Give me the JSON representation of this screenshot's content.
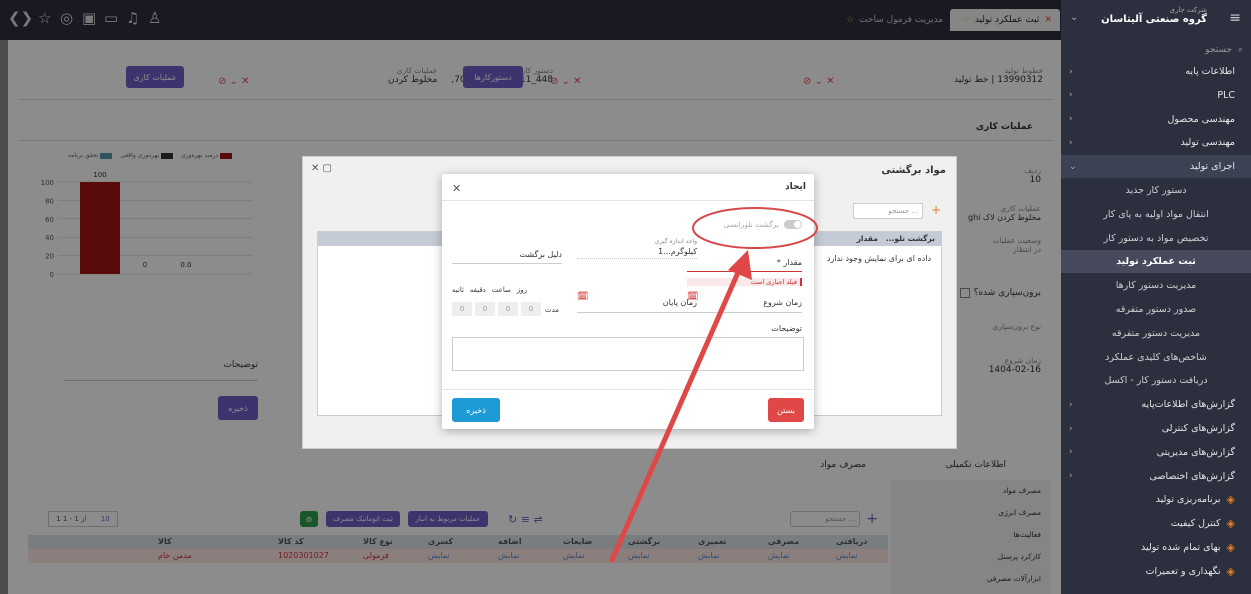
{
  "topbar": {
    "company_label": "شرکت جاری",
    "company_name": "گروه صنعتی آلیتاسان",
    "tab_active": "ثبت عملکرد تولید",
    "tab_inactive": "مدیریت فرمول ساخت"
  },
  "sidebar": {
    "search_placeholder": "جستجو",
    "items": [
      {
        "label": "اطلاعات پایه",
        "type": "group"
      },
      {
        "label": "PLC",
        "type": "group"
      },
      {
        "label": "مهندسی محصول",
        "type": "group"
      },
      {
        "label": "مهندسی تولید",
        "type": "group"
      },
      {
        "label": "اجرای تولید",
        "type": "open"
      },
      {
        "label": "دستور کار جدید",
        "type": "sub"
      },
      {
        "label": "انتقال مواد اولیه به پای کار",
        "type": "sub"
      },
      {
        "label": "تخصیص مواد به دستور کار",
        "type": "sub"
      },
      {
        "label": "ثبت عملکرد تولید",
        "type": "selected"
      },
      {
        "label": "مدیریت دستور کارها",
        "type": "sub"
      },
      {
        "label": "صدور دستور متفرقه",
        "type": "sub"
      },
      {
        "label": "مدیریت دستور متفرقه",
        "type": "sub"
      },
      {
        "label": "شاخص‌های کلیدی عملکرد",
        "type": "sub"
      },
      {
        "label": "دریافت دستور کار - اکسل",
        "type": "sub"
      },
      {
        "label": "گزارش‌های اطلاعات‌پایه",
        "type": "group"
      },
      {
        "label": "گزارش‌های کنترلی",
        "type": "group"
      },
      {
        "label": "گزارش‌های مدیریتی",
        "type": "group"
      },
      {
        "label": "گزارش‌های اختصاصی",
        "type": "group"
      },
      {
        "label": "برنامه‌ریزی تولید",
        "type": "module"
      },
      {
        "label": "کنترل کیفیت",
        "type": "module"
      },
      {
        "label": "بهای تمام شده تولید",
        "type": "module"
      },
      {
        "label": "نگهداری و تعمیرات",
        "type": "module"
      }
    ]
  },
  "header_row": {
    "line_label": "خطوط تولید",
    "line_value": "13990312 | خط تولید",
    "order_label": "دستور کار",
    "order_value": "448_13990311 بچ 707,",
    "orders_button": "دستورکارها",
    "op_label": "عملیات کاری",
    "op_value": "مخلوط کردن",
    "ops_button": "عملیات کاری"
  },
  "work_ops": {
    "title": "عملیات کاری",
    "row_label": "ردیف",
    "row_value": "10",
    "op_label": "عملیات کاری",
    "op_value": "مخلوط کردن لاک ghi",
    "status_label": "وضعیت عملیات",
    "status_value": "در انتظار",
    "outsource_label": "برون‌سپاری شده؟",
    "outsource_type_label": "نوع برون‌سپاری",
    "start_label": "زمان شروع",
    "start_value": "1404-02-16"
  },
  "chart_area": {
    "legend": [
      "درصد بهره‌وری",
      "بهره‌وری واقعی",
      "تحقق برنامه"
    ],
    "y_ticks": [
      "100",
      "80",
      "60",
      "40",
      "20",
      "0"
    ],
    "bar_labels": [
      "100",
      "0",
      "0.0"
    ],
    "desc_label": "توضیحات",
    "save_button": "ذخیره"
  },
  "returned_panel": {
    "title": "مواد برگشتی",
    "search_placeholder": "جستجو ...",
    "col_returned": "برگشت تلو...",
    "col_qty": "مقدار",
    "empty_text": "داده ای برای نمایش وجود ندارد"
  },
  "modal": {
    "title": "ایجاد",
    "toggle_label": "برگشت تلورانسی",
    "qty_label": "مقدار *",
    "qty_required": "فیلد اجباری است",
    "unit_label": "واحد اندازه گیری",
    "unit_value": "کیلوگرم...1",
    "reason_label": "دلیل برگشت",
    "start_label": "زمان شروع",
    "end_label": "زمان پایان",
    "duration_label": "مدت",
    "duration_units": [
      "روز",
      "ساعت",
      "دقیقه",
      "ثانیه"
    ],
    "duration_values": [
      "0",
      "0",
      "0",
      "0"
    ],
    "desc_label": "توضیحات",
    "close_button": "بستن",
    "save_button": "ذخیره"
  },
  "bottom": {
    "tech_info": "اطلاعات تکمیلی",
    "consume_title": "مصرف مواد",
    "side_tabs": [
      "مصرف مواد",
      "مصرف انرژی",
      "فعالیت‌ها",
      "کارکرد پرسنل",
      "ابزارآلات مصرفی"
    ],
    "search_placeholder": "جستجو ...",
    "related_ops": "عملیات مربوط به انبار",
    "auto_consume": "ثبت اتوماتیک مصرف",
    "pager": "1 از 1 - 1",
    "page_size": "10",
    "columns": [
      "دریافتی",
      "مصرفی",
      "تعمیری",
      "برگشتی",
      "ضایعات",
      "اضافه",
      "کسری",
      "نوع کالا",
      "کد کالا",
      "کالا"
    ],
    "row": [
      "نمایش",
      "نمایش",
      "نمایش",
      "نمایش",
      "نمایش",
      "نمایش",
      "نمایش",
      "فرمولی",
      "1020301027",
      "مدمن خام"
    ]
  }
}
